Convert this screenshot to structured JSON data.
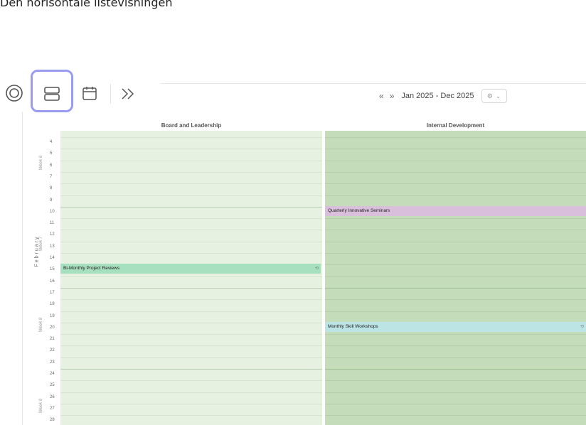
{
  "caption": "Den horisontale listevisningen",
  "toolbar": {
    "icons": [
      "target-icon",
      "horizontal-list-icon",
      "calendar-icon",
      "chevrons-right-icon"
    ],
    "selected": "horizontal-list-icon",
    "prev": "«",
    "next": "»",
    "range_label": "Jan 2025 - Dec 2025"
  },
  "columns": [
    {
      "name": "Board and Leadership"
    },
    {
      "name": "Internal Development"
    }
  ],
  "month": "February",
  "weeks": [
    "Week 6",
    "Week 7",
    "Week 8",
    "Week 9"
  ],
  "days": [
    "4",
    "5",
    "6",
    "7",
    "8",
    "9",
    "10",
    "11",
    "12",
    "13",
    "14",
    "15",
    "16",
    "17",
    "18",
    "19",
    "20",
    "21",
    "22",
    "23",
    "24",
    "25",
    "26",
    "27",
    "28"
  ],
  "events": [
    {
      "column": 0,
      "title": "Bi-Monthly Project Reviews",
      "day": "15",
      "color": "#a7e0bf",
      "repeat": true
    },
    {
      "column": 1,
      "title": "Quarterly Innovative Seminars",
      "day": "10",
      "color": "#d9bfdc",
      "repeat": false
    },
    {
      "column": 1,
      "title": "Monthly Skill Workshops",
      "day": "20",
      "color": "#bce4e4",
      "repeat": true
    }
  ]
}
